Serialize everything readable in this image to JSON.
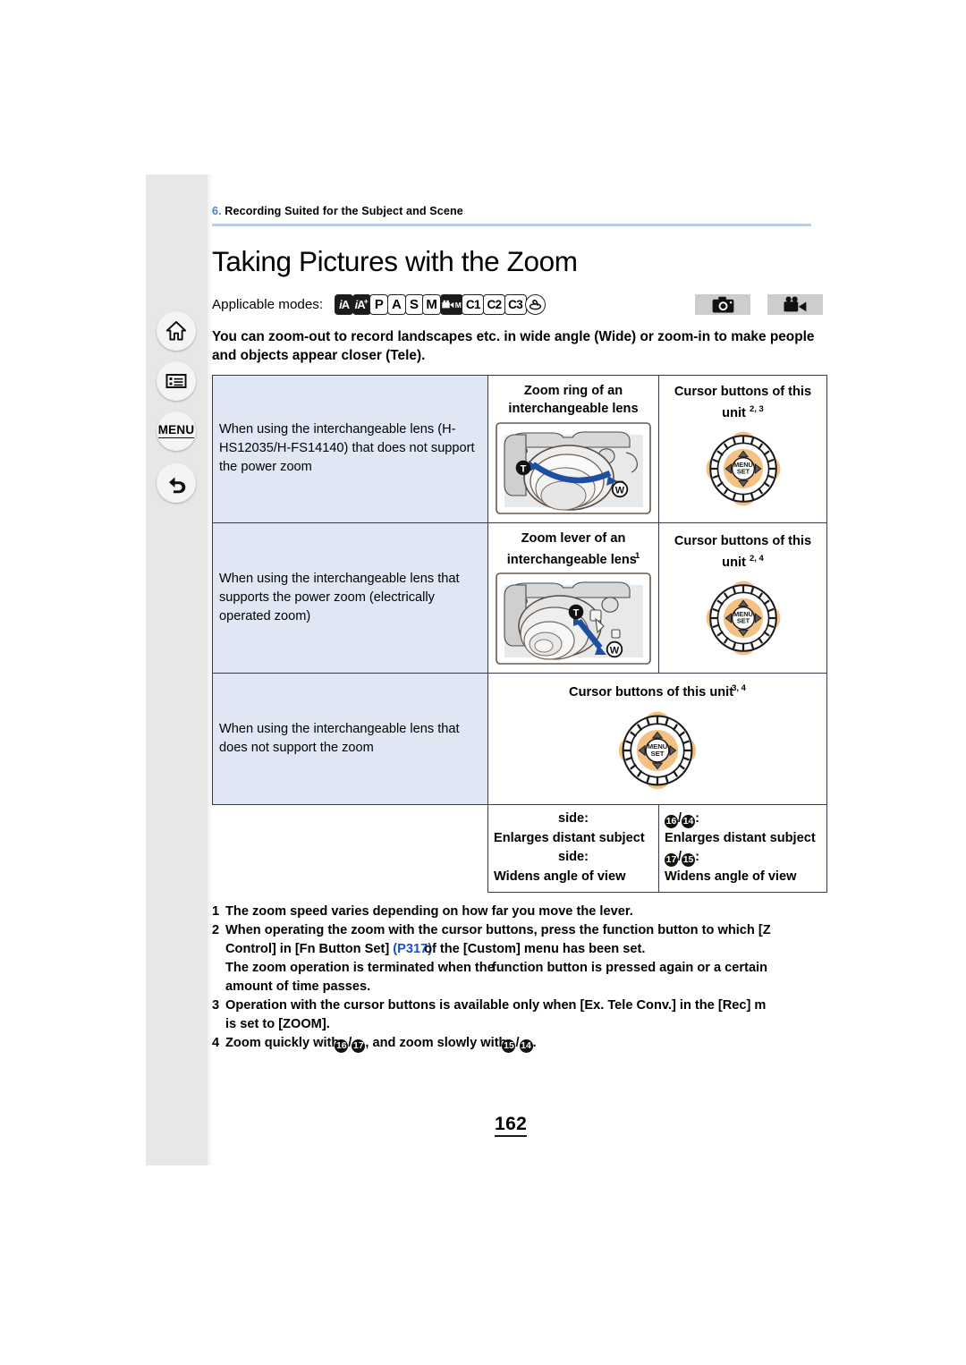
{
  "sidebar": {
    "items": [
      {
        "name": "home",
        "icon": "home-icon",
        "label": ""
      },
      {
        "name": "contents",
        "icon": "list-icon",
        "label": ""
      },
      {
        "name": "menu",
        "icon": "menu-text-icon",
        "label": "MENU"
      },
      {
        "name": "back",
        "icon": "back-arrow-icon",
        "label": ""
      }
    ]
  },
  "breadcrumb": {
    "number": "6.",
    "text": " Recording Suited for the Subject and Scene"
  },
  "header": {
    "title": "Taking Pictures with the Zoom"
  },
  "modes": {
    "label": "Applicable modes:",
    "items": [
      "iA",
      "iA+",
      "P",
      "A",
      "S",
      "M",
      "M",
      "C1",
      "C2",
      "C3"
    ],
    "badges": [
      "photo-camera-icon",
      "video-camera-icon"
    ]
  },
  "lead": "You can zoom-out to record landscapes etc. in wide angle (Wide) or zoom-in to make people and objects appear closer (Tele).",
  "table": {
    "rows": [
      {
        "desc": "When using the interchangeable lens (H-HS12035/H-FS14140) that does not support the power zoom",
        "mid_head": "Zoom ring of an interchangeable lens",
        "mid_head_sup": "",
        "right_head": "Cursor buttons of this unit",
        "right_head_sup": "2, 3"
      },
      {
        "desc": "When using the interchangeable lens that supports the power zoom (electrically operated zoom)",
        "mid_head": "Zoom lever of an interchangeable lens",
        "mid_head_sup": "1",
        "right_head": "Cursor buttons of this unit",
        "right_head_sup": "2, 4"
      },
      {
        "desc": "When using the interchangeable lens that does not support the zoom",
        "span_head": "Cursor buttons of this unit",
        "span_head_sup": "3, 4"
      }
    ],
    "legend": {
      "left": [
        {
          "key": "",
          "value": "side:"
        },
        {
          "key": "",
          "value": "Enlarges distant subject"
        },
        {
          "key": "",
          "value": "side:"
        },
        {
          "key": "",
          "value": "Widens angle of view"
        }
      ],
      "right": [
        {
          "key": "16/14",
          "value": ":"
        },
        {
          "key": "",
          "value": "Enlarges distant subject"
        },
        {
          "key": "17/15",
          "value": ":"
        },
        {
          "key": "",
          "value": "Widens angle of view"
        }
      ]
    }
  },
  "notes": [
    {
      "num": "1",
      "lines": [
        "The zoom speed varies depending on how far you move the lever."
      ]
    },
    {
      "num": "2",
      "lines": [
        "When operating the zoom with the cursor buttons, press the function button to which [Z",
        "Control] in [Fn Button Set] ",
        "(P317)",
        "of the [Custom] menu has been set.",
        "The zoom operation is terminated when the ",
        "function button is pressed again or a certain",
        "amount of time passes."
      ]
    },
    {
      "num": "3",
      "lines": [
        "Operation with the cursor buttons is available only when [Ex. Tele Conv.] in the [Rec] m",
        "is set to [ZOOM]."
      ]
    },
    {
      "num": "4",
      "lines": [
        "Zoom quickly with",
        "16",
        "/",
        "17",
        ", and zoom slowly with",
        "15",
        "/",
        "14",
        "."
      ]
    }
  ],
  "page_number": "162",
  "colors": {
    "rule": "#b9cfe6",
    "desc_cell_bg": "#dfe7f4",
    "link": "#1a4fd0",
    "dial_accent": "#f4c182",
    "arrow_blue": "#1c4fa1"
  }
}
